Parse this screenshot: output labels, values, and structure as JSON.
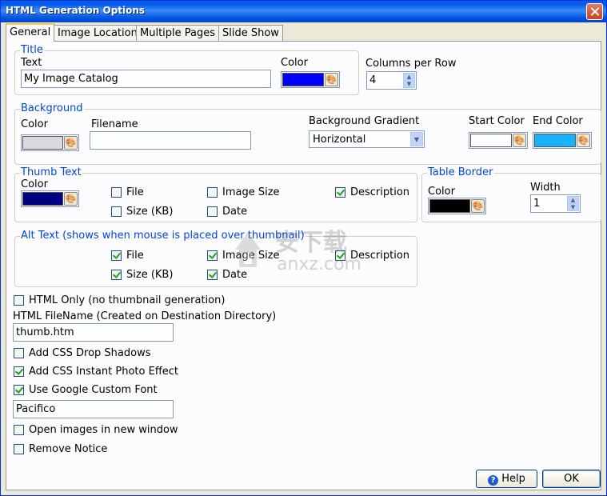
{
  "window": {
    "title": "HTML Generation Options"
  },
  "tabs": [
    "General",
    "Image Location",
    "Multiple Pages",
    "Slide Show"
  ],
  "title_group": {
    "heading": "Title",
    "text_label": "Text",
    "text_value": "My Image Catalog",
    "color_label": "Color",
    "color": "#0000ff"
  },
  "columns": {
    "label": "Columns per Row",
    "value": "4"
  },
  "background": {
    "heading": "Background",
    "color_label": "Color",
    "color": "#d9d9dc",
    "filename_label": "Filename",
    "filename_value": "",
    "gradient_label": "Background Gradient",
    "gradient_value": "Horizontal",
    "start_label": "Start Color",
    "start_color": "#ffffff",
    "end_label": "End Color",
    "end_color": "#1ab2ff"
  },
  "thumb_text": {
    "heading": "Thumb Text",
    "color_label": "Color",
    "color": "#000080",
    "options": [
      {
        "label": "File",
        "checked": false
      },
      {
        "label": "Size (KB)",
        "checked": false
      },
      {
        "label": "Image Size",
        "checked": false
      },
      {
        "label": "Date",
        "checked": false
      },
      {
        "label": "Description",
        "checked": true
      }
    ]
  },
  "table_border": {
    "heading": "Table Border",
    "color_label": "Color",
    "color": "#000000",
    "width_label": "Width",
    "width_value": "1"
  },
  "alt_text": {
    "heading": "Alt Text (shows when mouse is placed over thumbnail)",
    "options": [
      {
        "label": "File",
        "checked": true
      },
      {
        "label": "Size (KB)",
        "checked": true
      },
      {
        "label": "Image Size",
        "checked": true
      },
      {
        "label": "Date",
        "checked": true
      },
      {
        "label": "Description",
        "checked": true
      }
    ]
  },
  "html_only": {
    "label": "HTML Only (no thumbnail generation)",
    "checked": false
  },
  "filename": {
    "label": "HTML FileName (Created on Destination Directory)",
    "value": "thumb.htm"
  },
  "css_shadows": {
    "label": "Add CSS Drop Shadows",
    "checked": false
  },
  "css_photo": {
    "label": "Add CSS Instant Photo Effect",
    "checked": true
  },
  "google_font": {
    "label": "Use Google Custom Font",
    "checked": true,
    "value": "Pacifico"
  },
  "new_window": {
    "label": "Open images in new window",
    "checked": false
  },
  "remove_notice": {
    "label": "Remove Notice",
    "checked": false
  },
  "buttons": {
    "help": "Help",
    "ok": "OK"
  },
  "watermark": {
    "text": "安下载",
    "subtext": "anxz.com"
  }
}
